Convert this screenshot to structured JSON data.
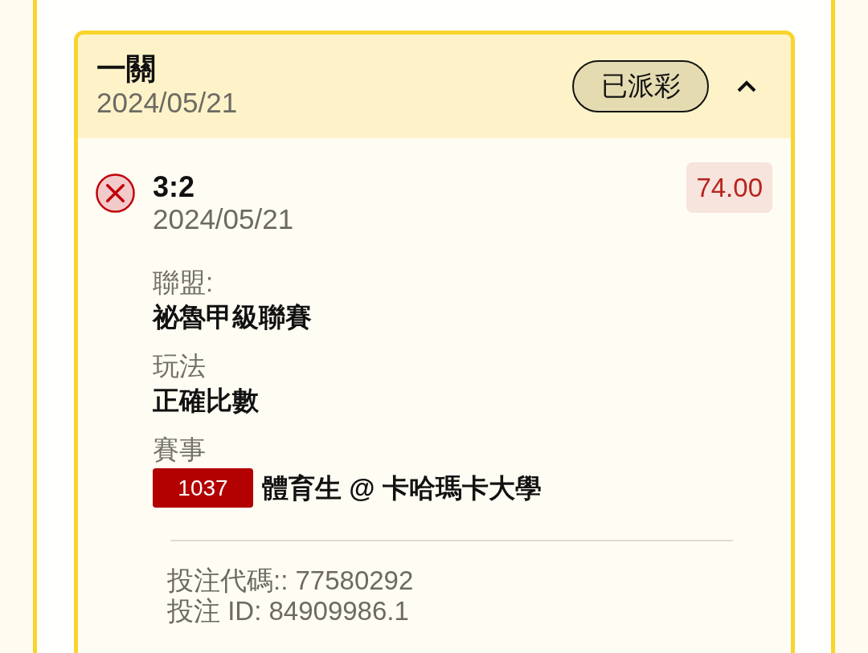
{
  "bet": {
    "title": "一關",
    "date": "2024/05/21",
    "status": "已派彩",
    "expanded": true
  },
  "selections": [
    {
      "won": false,
      "score": "3:2",
      "date": "2024/05/21",
      "amount": "74.00",
      "fields": [
        {
          "kind": "text",
          "label": "聯盟:",
          "value": "祕魯甲級聯賽"
        },
        {
          "kind": "text",
          "label": "玩法",
          "value": "正確比數"
        },
        {
          "kind": "match",
          "label": "賽事",
          "match_number": "1037",
          "value": "體育生 @ 卡哈瑪卡大學"
        }
      ]
    }
  ],
  "footer": {
    "lines": [
      "投注代碼:: 77580292",
      "投注 ID: 84909986.1"
    ]
  }
}
